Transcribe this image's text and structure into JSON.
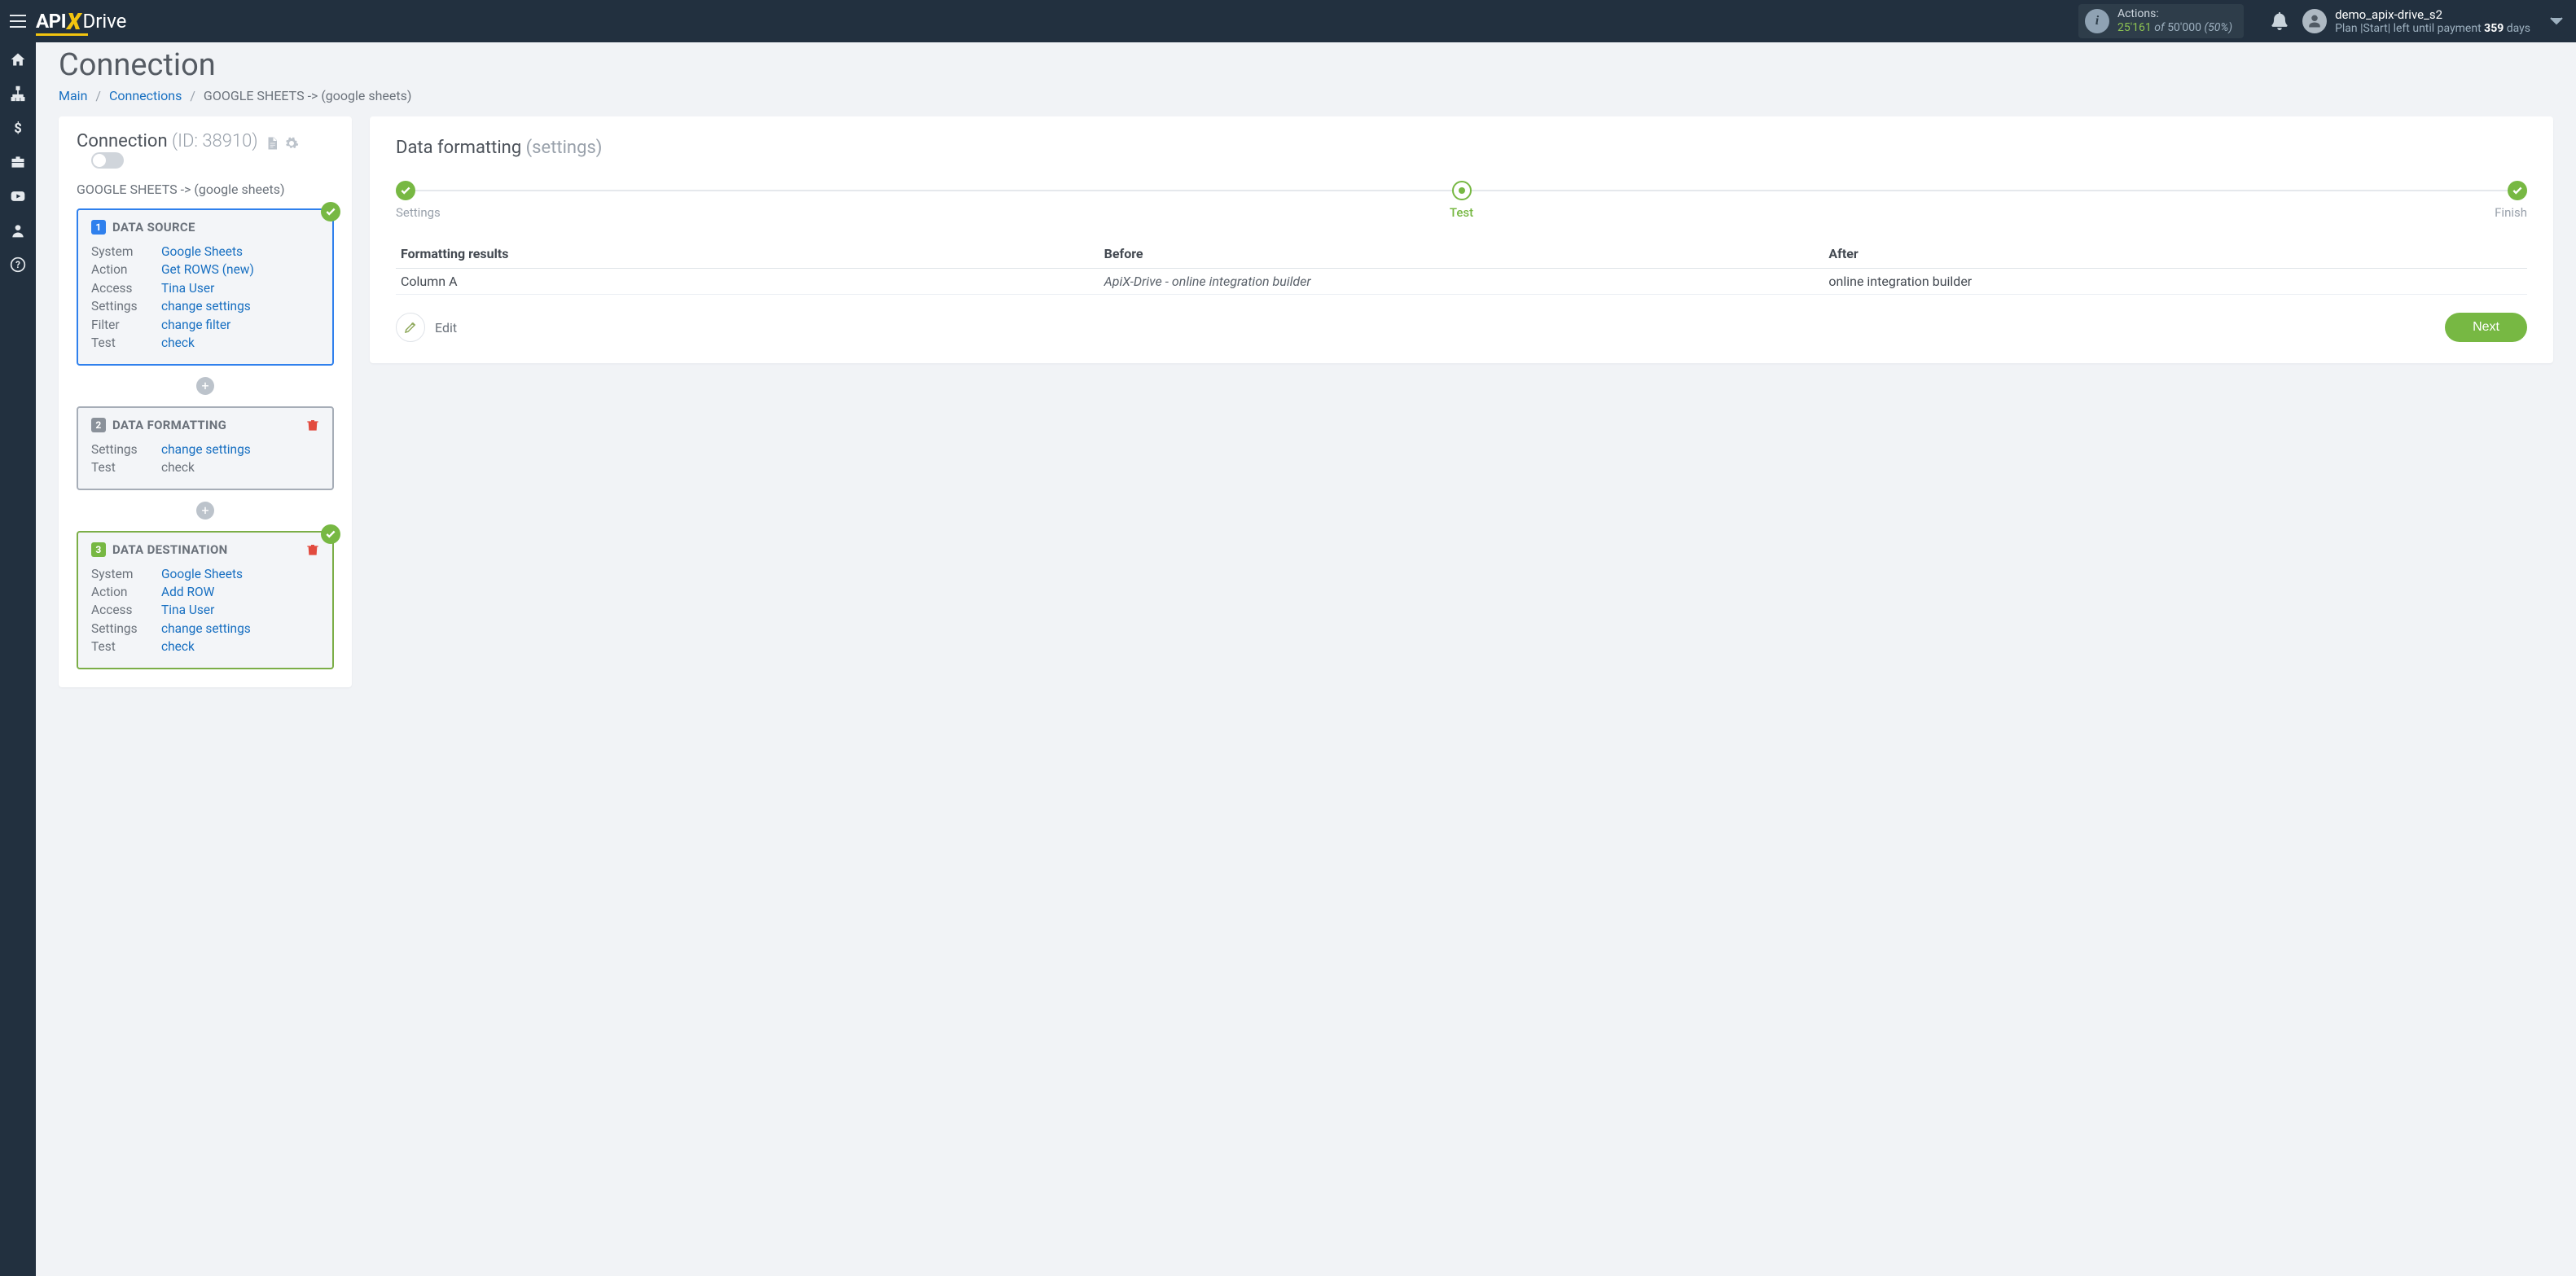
{
  "header": {
    "logo": {
      "api": "API",
      "x": "X",
      "drive": "Drive"
    },
    "actions": {
      "label": "Actions:",
      "used": "25'161",
      "of": "of",
      "total": "50'000",
      "pct": "(50%)"
    },
    "user": {
      "name": "demo_apix-drive_s2",
      "plan_prefix": "Plan |Start| left until payment ",
      "days": "359",
      "days_suffix": " days"
    }
  },
  "page": {
    "title": "Connection",
    "breadcrumbs": {
      "main": "Main",
      "connections": "Connections",
      "current": "GOOGLE SHEETS -> (google sheets)"
    }
  },
  "left": {
    "title": "Connection ",
    "id": "(ID: 38910)",
    "sub": "GOOGLE SHEETS -> (google sheets)",
    "source": {
      "title": "DATA SOURCE",
      "rows": {
        "system_k": "System",
        "system_v": "Google Sheets",
        "action_k": "Action",
        "action_v": "Get ROWS (new)",
        "access_k": "Access",
        "access_v": "Tina User",
        "settings_k": "Settings",
        "settings_v": "change settings",
        "filter_k": "Filter",
        "filter_v": "change filter",
        "test_k": "Test",
        "test_v": "check"
      }
    },
    "formatting": {
      "title": "DATA FORMATTING",
      "rows": {
        "settings_k": "Settings",
        "settings_v": "change settings",
        "test_k": "Test",
        "test_v": "check"
      }
    },
    "destination": {
      "title": "DATA DESTINATION",
      "rows": {
        "system_k": "System",
        "system_v": "Google Sheets",
        "action_k": "Action",
        "action_v": "Add ROW",
        "access_k": "Access",
        "access_v": "Tina User",
        "settings_k": "Settings",
        "settings_v": "change settings",
        "test_k": "Test",
        "test_v": "check"
      }
    }
  },
  "right": {
    "title": "Data formatting ",
    "title_sub": "(settings)",
    "steps": {
      "s1": "Settings",
      "s2": "Test",
      "s3": "Finish"
    },
    "table": {
      "h1": "Formatting results",
      "h2": "Before",
      "h3": "After",
      "r1c1": "Column A",
      "r1c2": "ApiX-Drive - online integration builder",
      "r1c3": "online integration builder"
    },
    "edit": "Edit",
    "next": "Next"
  }
}
